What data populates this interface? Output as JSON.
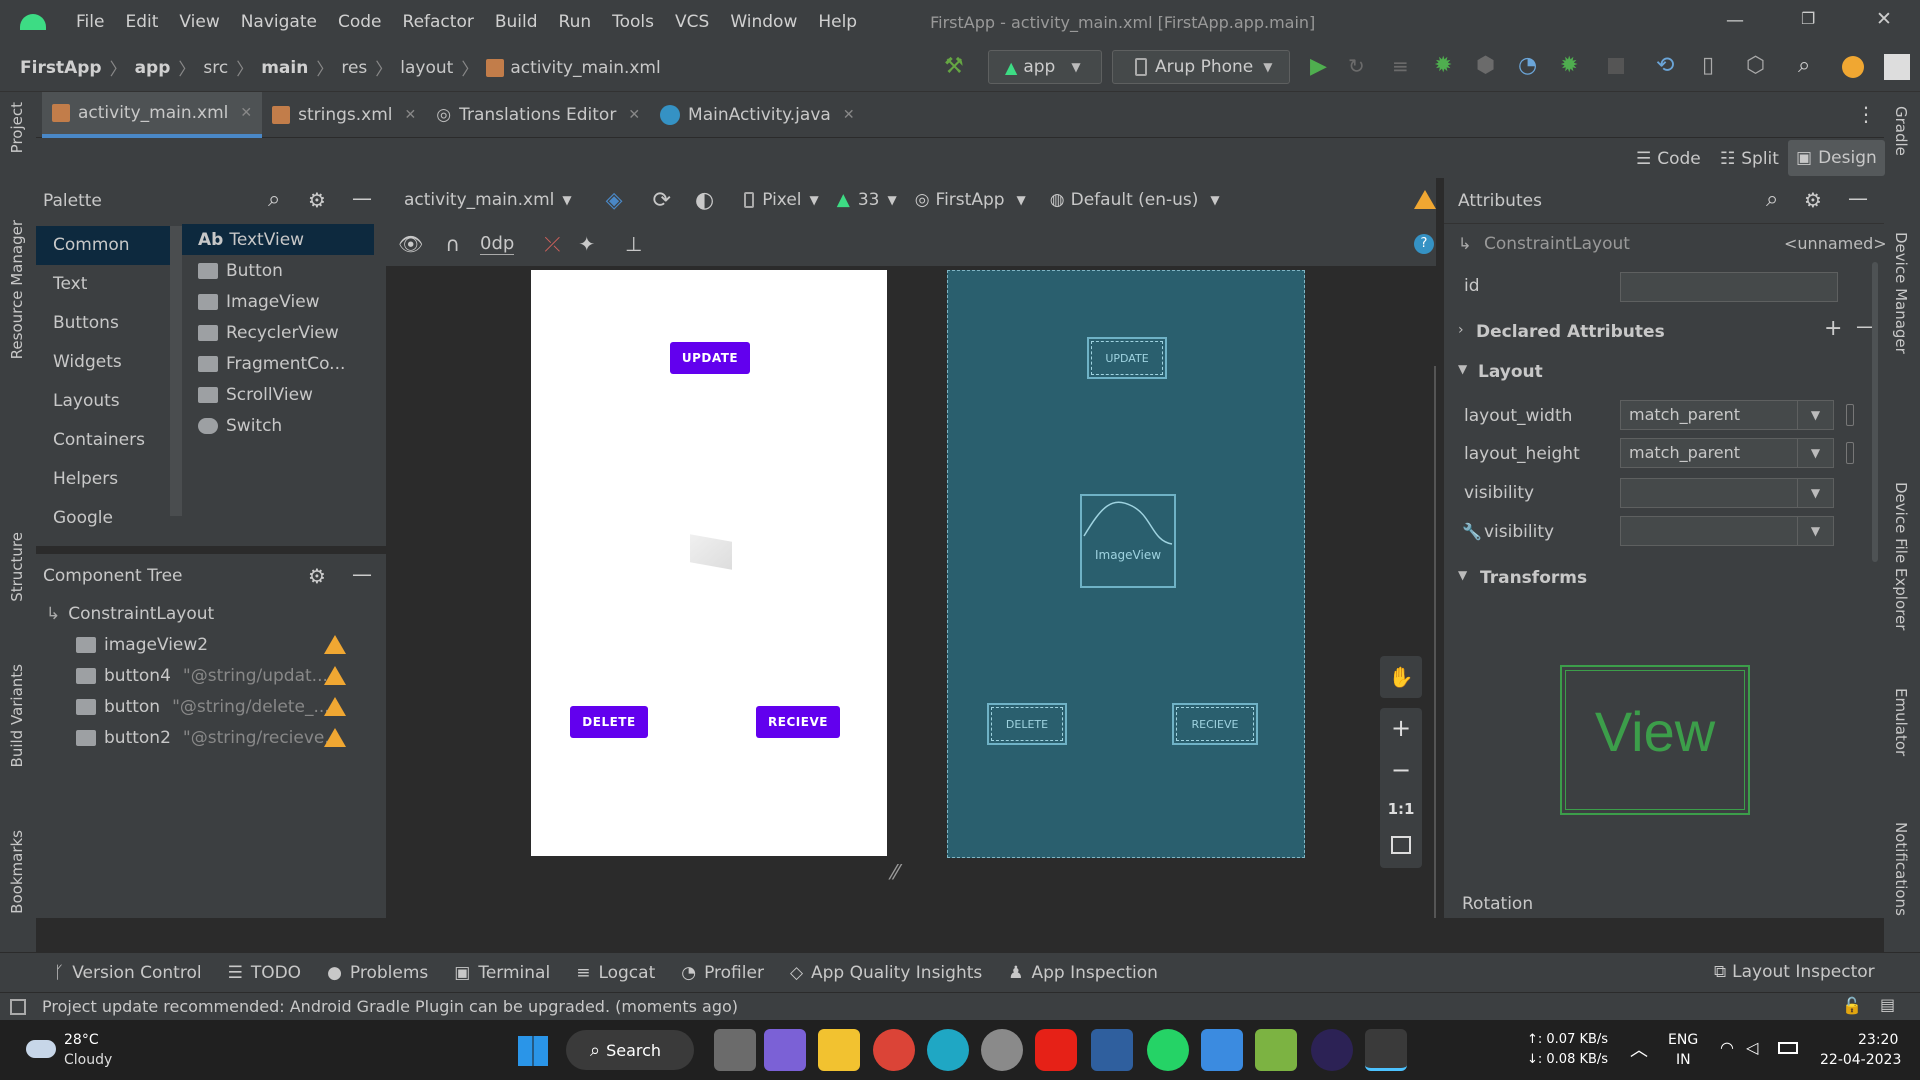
{
  "menu": {
    "items": [
      "File",
      "Edit",
      "View",
      "Navigate",
      "Code",
      "Refactor",
      "Build",
      "Run",
      "Tools",
      "VCS",
      "Window",
      "Help"
    ],
    "window_title": "FirstApp - activity_main.xml [FirstApp.app.main]"
  },
  "breadcrumb": [
    "FirstApp",
    "app",
    "src",
    "main",
    "res",
    "layout",
    "activity_main.xml"
  ],
  "run_config": {
    "module": "app",
    "device": "Arup Phone"
  },
  "tabs": [
    {
      "label": "activity_main.xml"
    },
    {
      "label": "strings.xml"
    },
    {
      "label": "Translations Editor"
    },
    {
      "label": "MainActivity.java"
    }
  ],
  "view_modes": {
    "code": "Code",
    "split": "Split",
    "design": "Design"
  },
  "left_strip": {
    "project": "Project",
    "resource_manager": "Resource Manager",
    "structure": "Structure",
    "build_variants": "Build Variants",
    "bookmarks": "Bookmarks"
  },
  "right_strip": {
    "gradle": "Gradle",
    "device_manager": "Device Manager",
    "device_file_explorer": "Device File Explorer",
    "emulator": "Emulator",
    "notifications": "Notifications"
  },
  "palette": {
    "title": "Palette",
    "categories": [
      "Common",
      "Text",
      "Buttons",
      "Widgets",
      "Layouts",
      "Containers",
      "Helpers",
      "Google"
    ],
    "widgets": [
      "TextView",
      "Button",
      "ImageView",
      "RecyclerView",
      "FragmentCo...",
      "ScrollView",
      "Switch"
    ],
    "textview_prefix": "Ab"
  },
  "component_tree": {
    "title": "Component Tree",
    "root": "ConstraintLayout",
    "items": [
      {
        "name": "imageView2",
        "value": ""
      },
      {
        "name": "button4",
        "value": "\"@string/updat..."
      },
      {
        "name": "button",
        "value": "\"@string/delete_..."
      },
      {
        "name": "button2",
        "value": "\"@string/recieve..."
      }
    ]
  },
  "design_toolbar": {
    "file": "activity_main.xml",
    "device": "Pixel",
    "api": "33",
    "theme": "FirstApp",
    "locale": "Default (en-us)",
    "margin": "0dp"
  },
  "preview": {
    "update": "UPDATE",
    "delete": "DELETE",
    "recieve": "RECIEVE",
    "imageview": "ImageView"
  },
  "zoom_controls": {
    "one_to_one": "1:1"
  },
  "attributes": {
    "title": "Attributes",
    "component": "ConstraintLayout",
    "unnamed": "<unnamed>",
    "id_label": "id",
    "declared": "Declared Attributes",
    "layout_section": "Layout",
    "layout_width_label": "layout_width",
    "layout_width_value": "match_parent",
    "layout_height_label": "layout_height",
    "layout_height_value": "match_parent",
    "visibility_label": "visibility",
    "tools_visibility_label": "visibility",
    "transforms": "Transforms",
    "view_text": "View",
    "rotation": "Rotation"
  },
  "bottom_tools": [
    "Version Control",
    "TODO",
    "Problems",
    "Terminal",
    "Logcat",
    "Profiler",
    "App Quality Insights",
    "App Inspection"
  ],
  "layout_inspector": "Layout Inspector",
  "status": {
    "message": "Project update recommended: Android Gradle Plugin can be upgraded. (moments ago)"
  },
  "taskbar": {
    "weather_temp": "28°C",
    "weather_desc": "Cloudy",
    "search": "Search",
    "net_up": "↑: 0.07 KB/s",
    "net_down": "↓: 0.08 KB/s",
    "lang1": "ENG",
    "lang2": "IN",
    "time": "23:20",
    "date": "22-04-2023"
  },
  "colors": {
    "accent": "#6200ee",
    "blueprint": "#2a5f6e",
    "ide_bg": "#3c3f41",
    "warning": "#f0a732"
  }
}
